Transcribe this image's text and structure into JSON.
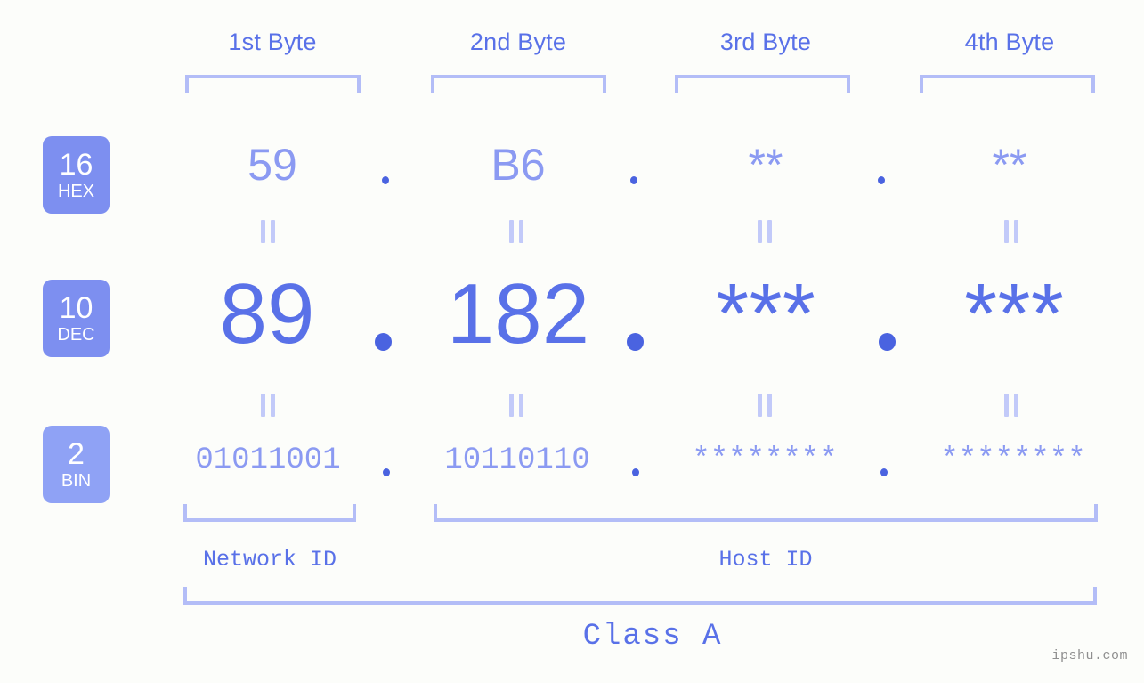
{
  "page": {
    "background": "#fcfdfa",
    "accent": "#5971e8",
    "accent_light": "#8b9af2",
    "bracket_color": "#b3bdf7",
    "watermark": "ipshu.com"
  },
  "byte_headers": [
    {
      "label": "1st Byte"
    },
    {
      "label": "2nd Byte"
    },
    {
      "label": "3rd Byte"
    },
    {
      "label": "4th Byte"
    }
  ],
  "bases": [
    {
      "num": "16",
      "name": "HEX",
      "color": "#7d8ff0"
    },
    {
      "num": "10",
      "name": "DEC",
      "color": "#7d8ff0"
    },
    {
      "num": "2",
      "name": "BIN",
      "color": "#8fa2f5"
    }
  ],
  "rows": {
    "hex": {
      "base_num": "16",
      "base_name": "HEX",
      "octets": [
        "59",
        "B6",
        "**",
        "**"
      ],
      "separator": "."
    },
    "dec": {
      "base_num": "10",
      "base_name": "DEC",
      "octets": [
        "89",
        "182",
        "***",
        "***"
      ],
      "separator": "."
    },
    "bin": {
      "base_num": "2",
      "base_name": "BIN",
      "octets": [
        "01011001",
        "10110110",
        "********",
        "********"
      ],
      "separator": "."
    }
  },
  "equals_marks": {
    "symbol": "||",
    "count_per_row": 4
  },
  "id_sections": [
    {
      "label": "Network ID"
    },
    {
      "label": "Host ID"
    }
  ],
  "class_section": {
    "label": "Class A"
  }
}
